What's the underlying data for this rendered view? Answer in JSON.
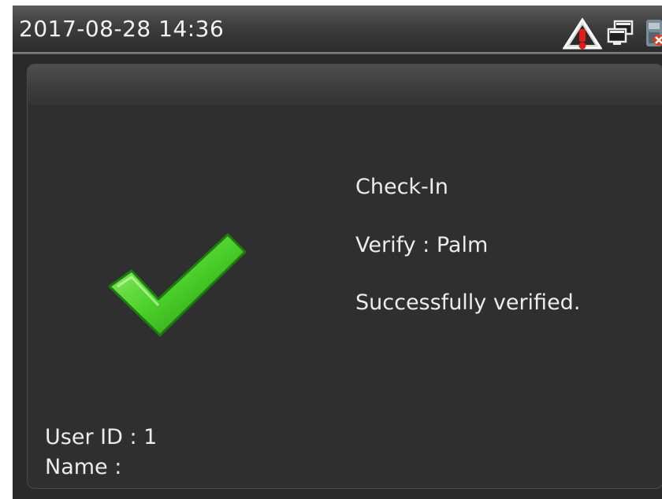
{
  "status_bar": {
    "datetime": "2017-08-28 14:36",
    "icons": [
      "warning-icon",
      "network-icon",
      "usb-icon"
    ]
  },
  "result": {
    "status_icon": "check-icon",
    "status_color": "#4cd02a",
    "lines": [
      "Check-In",
      "Verify : Palm",
      "Successfully verified."
    ]
  },
  "user": {
    "id_label": "User ID : 1",
    "name_label": "Name :"
  }
}
